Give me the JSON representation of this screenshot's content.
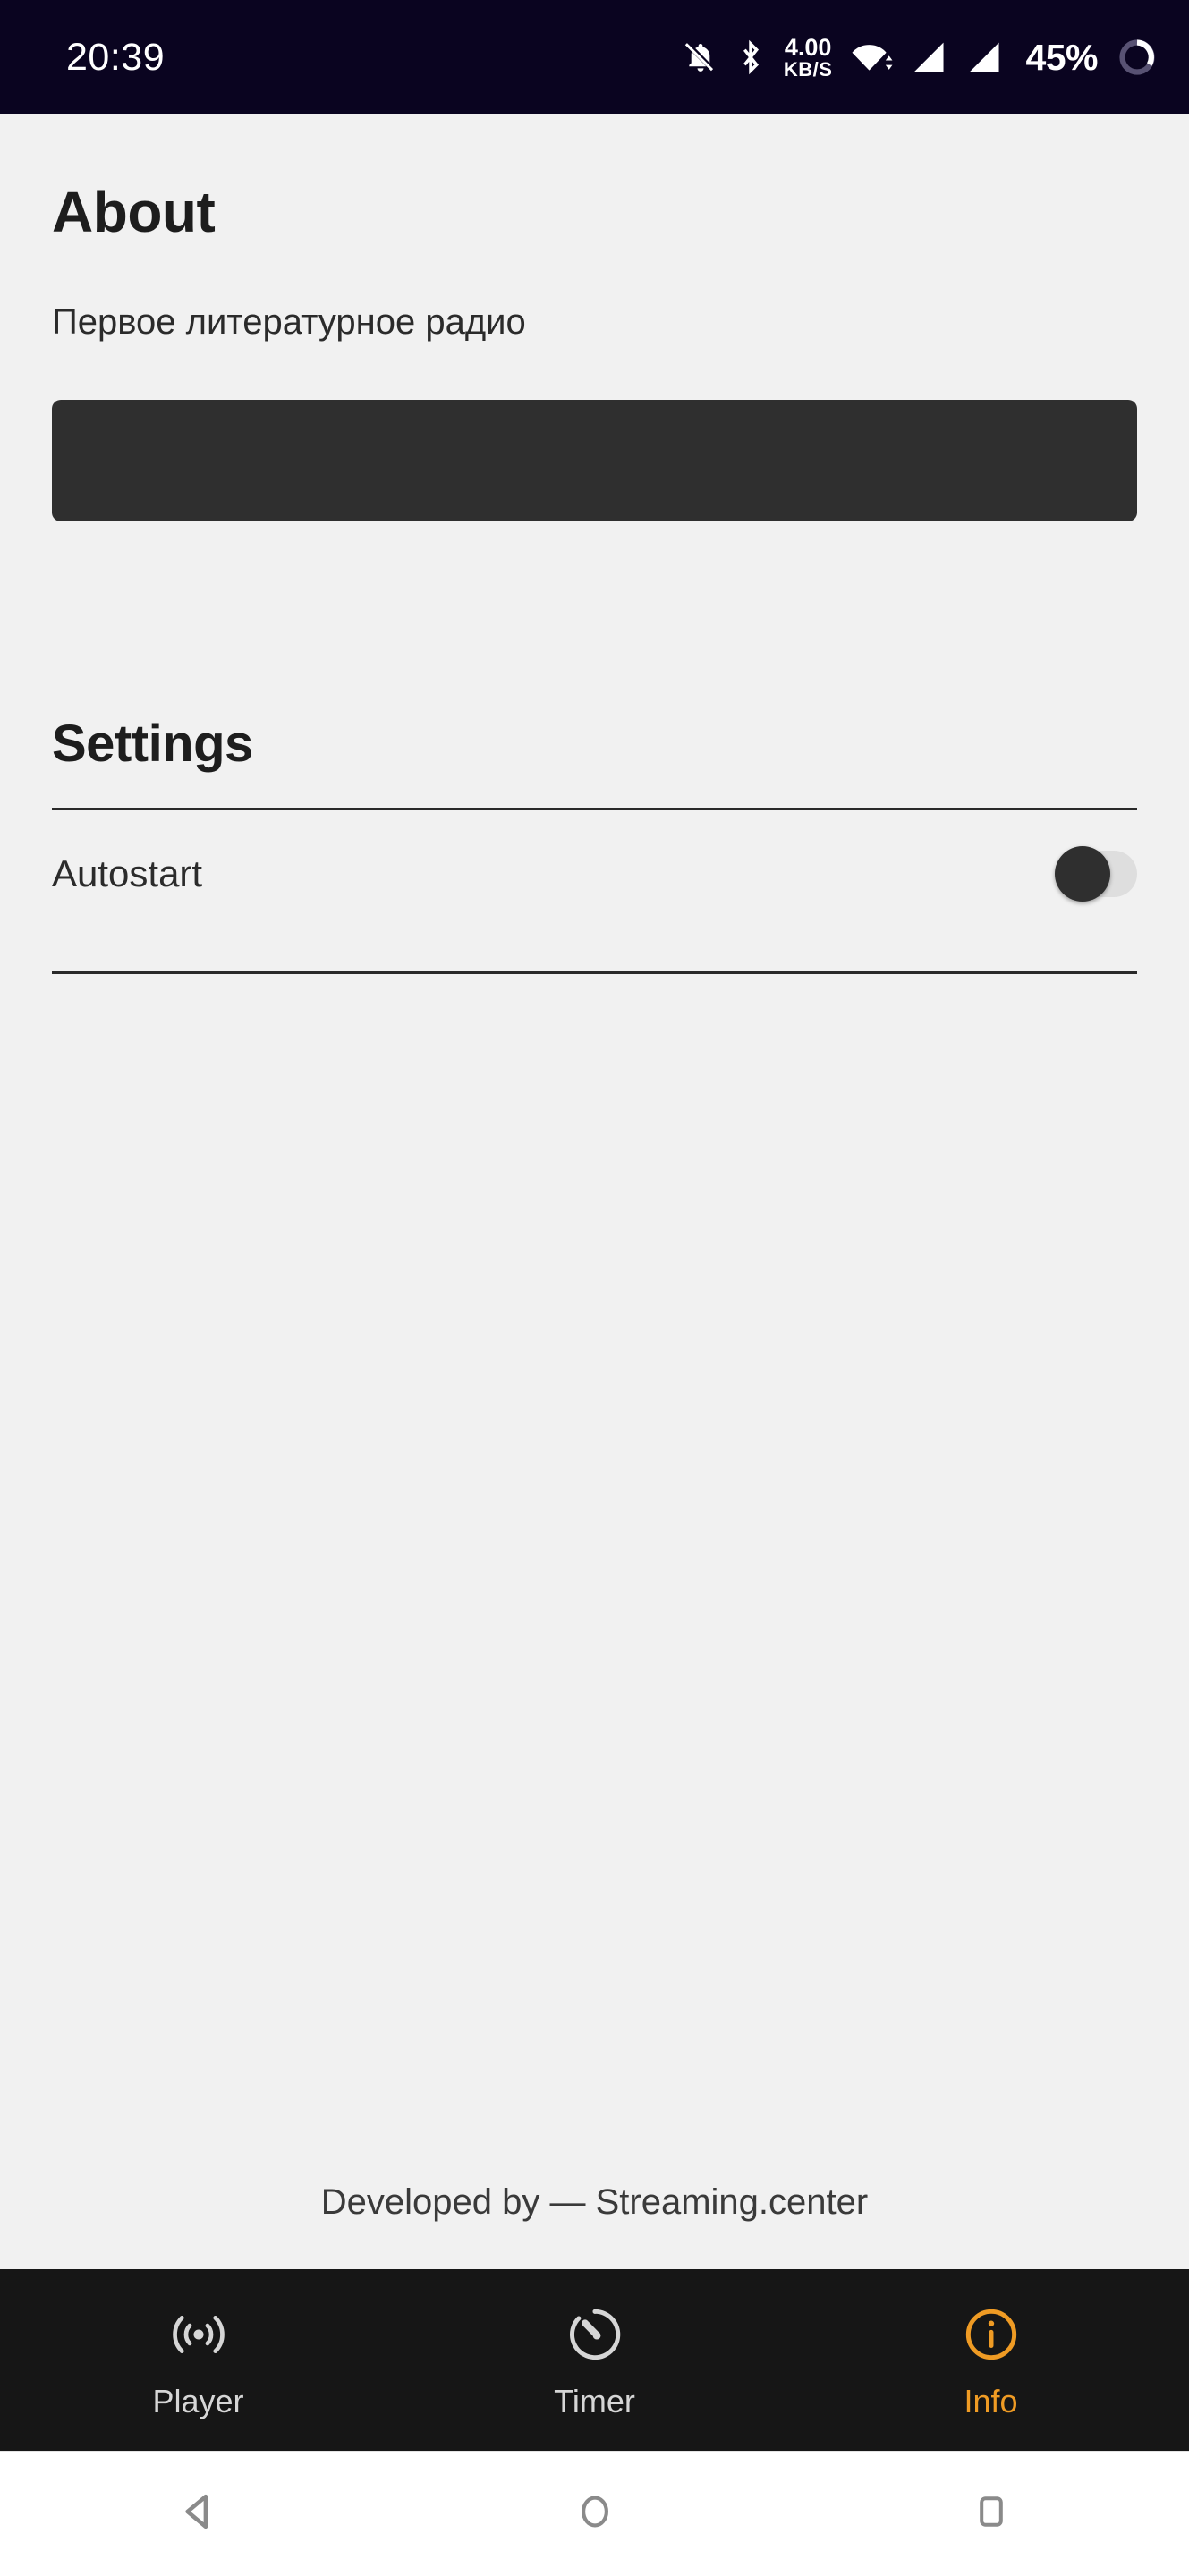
{
  "status_bar": {
    "clock": "20:39",
    "data_rate_value": "4.00",
    "data_rate_unit": "KB/S",
    "battery_percent": "45%",
    "icons": [
      "notifications-off-icon",
      "bluetooth-icon",
      "network-speed-icon",
      "wifi-icon",
      "signal-sim1-icon",
      "signal-sim2-icon",
      "battery-ring-icon"
    ],
    "background_color": "#0a0420",
    "foreground_color": "#ffffff"
  },
  "about": {
    "heading": "About",
    "description": "Первое литературное радио",
    "banner_color": "#2f2f2f"
  },
  "settings": {
    "heading": "Settings",
    "rows": [
      {
        "label": "Autostart",
        "toggle_on": false
      }
    ]
  },
  "footer": {
    "credit": "Developed by — Streaming.center"
  },
  "tabbar": {
    "background_color": "#161616",
    "active_color": "#ef9b24",
    "inactive_color": "#d6d6d6",
    "tabs": [
      {
        "label": "Player",
        "icon": "radio-broadcast-icon",
        "active": false
      },
      {
        "label": "Timer",
        "icon": "timer-icon",
        "active": false
      },
      {
        "label": "Info",
        "icon": "info-circle-icon",
        "active": true
      }
    ]
  },
  "android_nav": {
    "buttons": [
      {
        "name": "back",
        "icon": "back-triangle-icon"
      },
      {
        "name": "home",
        "icon": "home-circle-icon"
      },
      {
        "name": "recents",
        "icon": "recents-square-icon"
      }
    ]
  }
}
